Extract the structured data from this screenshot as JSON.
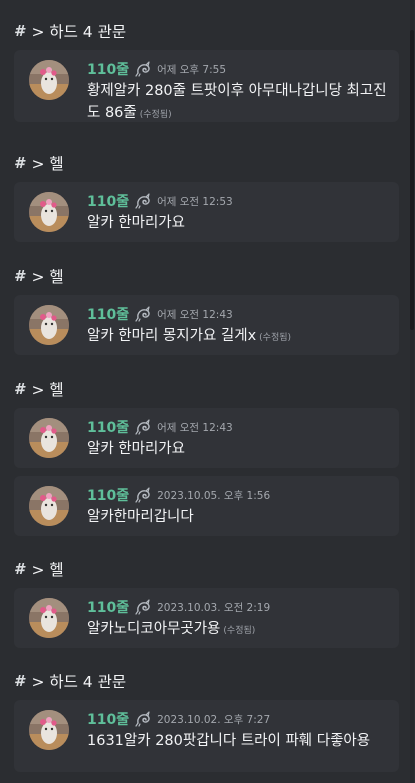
{
  "groups": [
    {
      "crumb": "> 하드 4 관문",
      "messages": [
        {
          "user": "110줄",
          "time": "어제 오후 7:55",
          "text": "황제알카 280줄 트팟이후 아무대나갑니당 최고진도 86줄",
          "edited": "(수정됨)"
        }
      ]
    },
    {
      "crumb": "> 헬",
      "messages": [
        {
          "user": "110줄",
          "time": "어제 오전 12:53",
          "text": "알카 한마리가요",
          "edited": ""
        }
      ]
    },
    {
      "crumb": "> 헬",
      "messages": [
        {
          "user": "110줄",
          "time": "어제 오전 12:43",
          "text": "알카 한마리 몽지가요 길게x",
          "edited": "(수정됨)"
        }
      ]
    },
    {
      "crumb": "> 헬",
      "messages": [
        {
          "user": "110줄",
          "time": "어제 오전 12:43",
          "text": "알카 한마리가요",
          "edited": ""
        },
        {
          "user": "110줄",
          "time": "2023.10.05. 오후 1:56",
          "text": "알카한마리갑니다",
          "edited": ""
        }
      ]
    },
    {
      "crumb": "> 헬",
      "messages": [
        {
          "user": "110줄",
          "time": "2023.10.03. 오전 2:19",
          "text": "알카노디코아무곳가용",
          "edited": "(수정됨)"
        }
      ]
    },
    {
      "crumb": "> 하드 4 관문",
      "messages": [
        {
          "user": "110줄",
          "time": "2023.10.02. 오후 7:27",
          "text": "1631알카 280팟갑니다 트라이 파훼 다좋아용",
          "edited": ""
        }
      ]
    }
  ],
  "icons": {
    "channel": "hash-icon",
    "role": "dragon-role-icon",
    "avatar": "user-avatar"
  },
  "colors": {
    "background": "#2b2d31",
    "card": "#313338",
    "username": "#5fbf9a"
  }
}
